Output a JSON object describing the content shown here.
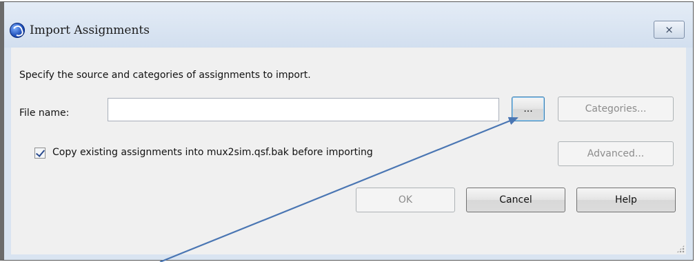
{
  "dialog": {
    "title": "Import Assignments",
    "close_label": "⨯",
    "instruction": "Specify the source and categories of assignments to import.",
    "file_name_label": "File name:",
    "file_name_value": "",
    "browse_label": "...",
    "categories_label": "Categories...",
    "checkbox_label": "Copy existing assignments into mux2sim.qsf.bak before importing",
    "checkbox_checked": true,
    "advanced_label": "Advanced...",
    "ok_label": "OK",
    "cancel_label": "Cancel",
    "help_label": "Help"
  },
  "colors": {
    "annotation_arrow": "#4a76b3"
  },
  "icons": [
    "app-globe-icon",
    "close-icon",
    "checkmark-icon",
    "resize-grip-icon",
    "annotation-arrow"
  ]
}
